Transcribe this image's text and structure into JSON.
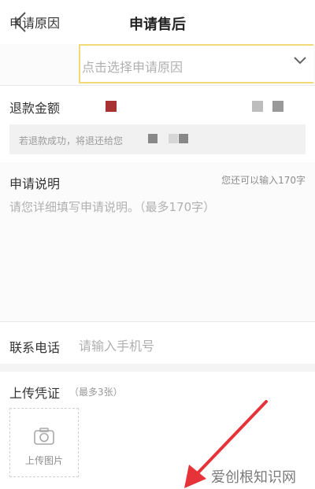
{
  "header": {
    "title": "申请售后",
    "back_icon": "chevron-left-icon"
  },
  "reason": {
    "label": "申请原因",
    "placeholder": "点击选择申请原因",
    "chevron_icon": "chevron-down-icon",
    "border_color": "#f2d97a"
  },
  "refund": {
    "label": "退款金额",
    "note": "若退款成功，将退还给您"
  },
  "description": {
    "label": "申请说明",
    "counter": "您还可以输入170字",
    "placeholder": "请您详细填写申请说明。（最多170字）"
  },
  "phone": {
    "label": "联系电话",
    "placeholder": "请输入手机号"
  },
  "upload": {
    "label": "上传凭证",
    "hint": "（最多3张）",
    "box_label": "上传图片",
    "camera_icon": "camera-icon"
  },
  "watermark": "爱创根知识网"
}
